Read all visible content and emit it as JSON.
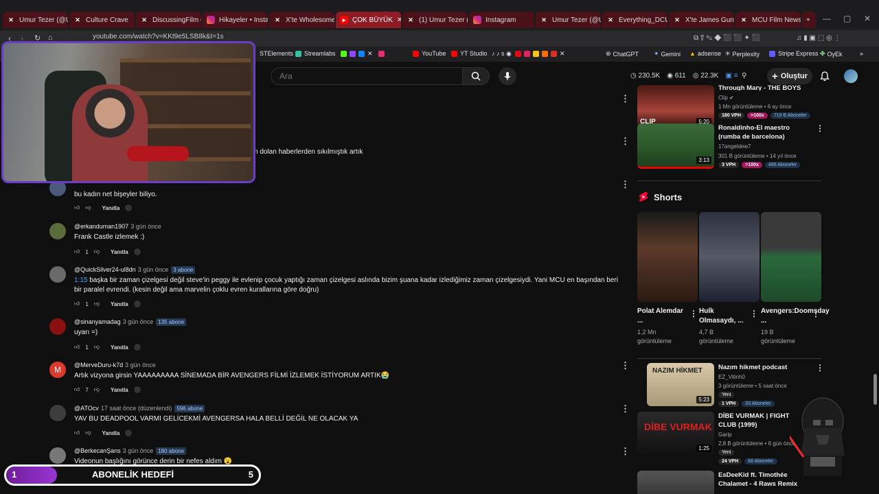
{
  "tabs": [
    {
      "label": "Umur Tezer (@Ur",
      "icon": "x-icon",
      "style": "red"
    },
    {
      "label": "Culture Crave",
      "icon": "x-icon",
      "style": "red"
    },
    {
      "label": "DiscussingFilm (@",
      "icon": "x-icon",
      "style": "red"
    },
    {
      "label": "Hikayeler • Instag",
      "icon": "instagram-icon",
      "style": "red"
    },
    {
      "label": "X'te Wholesome",
      "icon": "x-icon",
      "style": "red"
    },
    {
      "label": "ÇOK BÜYÜK",
      "icon": "youtube-icon",
      "style": "active"
    },
    {
      "label": "(1) Umur Tezer (@",
      "icon": "x-icon",
      "style": "red"
    },
    {
      "label": "Instagram",
      "icon": "instagram-icon",
      "style": "red"
    },
    {
      "label": "Umur Tezer (@Ur",
      "icon": "x-icon",
      "style": "red"
    },
    {
      "label": "Everything_DCU",
      "icon": "x-icon",
      "style": "red"
    },
    {
      "label": "X'te James Gunn",
      "icon": "x-icon",
      "style": "red"
    },
    {
      "label": "MCU Film News |",
      "icon": "x-icon",
      "style": "red"
    }
  ],
  "address": {
    "url": "youtube.com/watch?v=KKt9e5LSB8k&t=1s"
  },
  "bookmarks": [
    "STElements",
    "Streamlabs",
    "YouTube",
    "YT Studio",
    "ChatGPT",
    "Gemini",
    "adsense",
    "Perplexity",
    "Stripe Express",
    "OyEk"
  ],
  "header": {
    "search_placeholder": "Ara",
    "stats": [
      "230.5K",
      "611",
      "22.3K"
    ],
    "create_label": "Oluştur"
  },
  "comments": [
    {
      "text_partial": "n dolan haberlerden sıkılmıştık artık"
    },
    {
      "author": "",
      "time": "",
      "text": "bu kadın net bişeyler biliyo.",
      "likes": "",
      "reply": "Yanıtla"
    },
    {
      "author": "@erkanduman1907",
      "time": "3 gün önce",
      "text": "Frank Castle izlemek :)",
      "likes": "1",
      "reply": "Yanıtla"
    },
    {
      "author": "@QuickSilver24-ul8dn",
      "time": "3 gün önce",
      "badge": "3 abone",
      "timestamp": "1:15",
      "text": " başka bir zaman çizelgesi değil steve'in peggy ile evlenip çocuk yaptığı zaman çizelgesi aslında bizim şuana kadar izlediğimiz zaman çizelgesiydi. Yani MCU en başından beri bir paralel evrendi. (kesin değil ama marvelin çoklu evren kurallarına göre doğru)",
      "likes": "1",
      "reply": "Yanıtla"
    },
    {
      "author": "@sinanyamadag",
      "time": "3 gün önce",
      "badge": "135 abone",
      "text": "uyarı =)",
      "likes": "1",
      "reply": "Yanıtla"
    },
    {
      "author": "@MerveDuru-k7d",
      "time": "3 gün önce",
      "avatar_letter": "M",
      "text": "Artık vizyona girsin YAAAAAAAAA SİNEMADA BİR AVENGERS FİLMİ İZLEMEK İSTİYORUM ARTIK😭",
      "likes": "7",
      "reply": "Yanıtla"
    },
    {
      "author": "@ATOcv",
      "time": "17 saat önce (düzenlendi)",
      "badge": "596 abone",
      "text": "YAV BU DEADPOOL VARMI GELİCEKMİ AVENGERSA HALA BELLİ DEĞİL NE OLACAK YA",
      "likes": "",
      "reply": "Yanıtla"
    },
    {
      "author": "@BerkecanŞans",
      "time": "3 gün önce",
      "badge": "180 abone",
      "text": "Videonun başlığını görünce derin bir nefes aldım 😮",
      "likes": "",
      "reply": ""
    }
  ],
  "sidebar": {
    "videos_top": [
      {
        "title": "Through Mary - THE BOYS Clip",
        "channel": "Clip ✔",
        "meta": "1 Mn görüntüleme • 6 ay önce",
        "duration": "5:20",
        "pills": [
          "180 VPH",
          ">100x",
          "719 B Aboneler"
        ],
        "thumb_label": "CLIP"
      },
      {
        "title": "Ronaldinho-El maestro (rumba de barcelona)",
        "channel": "17angeldew7",
        "meta": "301 B görüntüleme • 14 yıl önce",
        "duration": "3:13",
        "pills": [
          "3 VPH",
          ">100x",
          "496 Aboneler"
        ]
      }
    ],
    "shorts_title": "Shorts",
    "shorts": [
      {
        "title": "Polat Alemdar ...",
        "views": "1,2 Mn görüntüleme"
      },
      {
        "title": "Hulk Olmasaydı, ...",
        "views": "4,7 B görüntüleme"
      },
      {
        "title": "Avengers:Doomsday ...",
        "views": "19 B görüntüleme"
      }
    ],
    "videos_bottom": [
      {
        "title": "Nazım hikmet podcast",
        "channel": "EZ_Vitinh0",
        "meta": "3 görüntüleme • 5 saat önce",
        "tag": "Yeni",
        "duration": "5:23",
        "pills": [
          "1 VPH",
          "33 Aboneler"
        ],
        "thumb_label": "NAZIM HİKMET"
      },
      {
        "title": "DİBE VURMAK | FIGHT CLUB (1999)",
        "channel": "Garip",
        "meta": "2,8 B görüntüleme • 6 gün önce",
        "tag": "Yeni",
        "duration": "1:25",
        "pills": [
          "24 VPH",
          "68 Aboneler"
        ],
        "thumb_label": "DİBE VURMAK"
      },
      {
        "title": "EsDeeKid ft. Timothée Chalamet - 4 Raws Remix"
      }
    ]
  },
  "goal": {
    "left": "1",
    "title": "ABONELİK HEDEFİ",
    "right": "5",
    "progress": 0.2
  },
  "colors": {
    "tab_active": "#8f1c24",
    "goal_border": "#ffffff",
    "accent_purple": "#6a3ec8",
    "link_blue": "#3ea6ff",
    "pink": "#a5155c"
  }
}
